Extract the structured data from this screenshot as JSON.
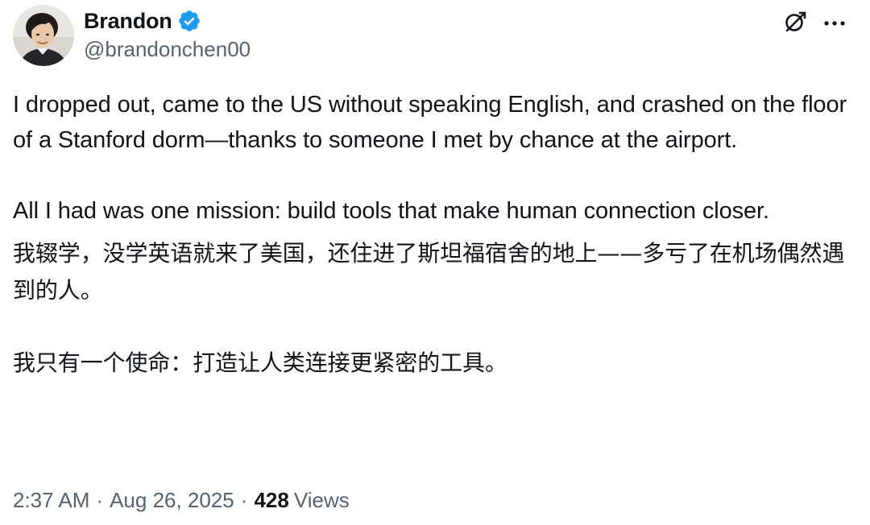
{
  "author": {
    "display_name": "Brandon",
    "handle": "@brandonchen00",
    "verified": true,
    "verified_color": "#1d9bf0"
  },
  "header_icons": {
    "grok": "grok-icon",
    "more": "more-icon"
  },
  "tweet": {
    "en_p1": "I dropped out, came to the US without speaking English, and crashed on the floor of a Stanford dorm—thanks to someone I met by chance at the airport.",
    "en_p2": "All I had was one mission: build tools that make human connection closer.",
    "cn_p1": "我辍学，没学英语就来了美国，还住进了斯坦福宿舍的地上——多亏了在机场偶然遇到的人。",
    "cn_p2": "我只有一个使命：打造让人类连接更紧密的工具。"
  },
  "meta": {
    "time": "2:37 AM",
    "separator": "·",
    "date": "Aug 26, 2025",
    "views_count": "428",
    "views_label": "Views"
  },
  "colors": {
    "text": "#0f1419",
    "secondary": "#536471",
    "accent": "#1d9bf0"
  }
}
